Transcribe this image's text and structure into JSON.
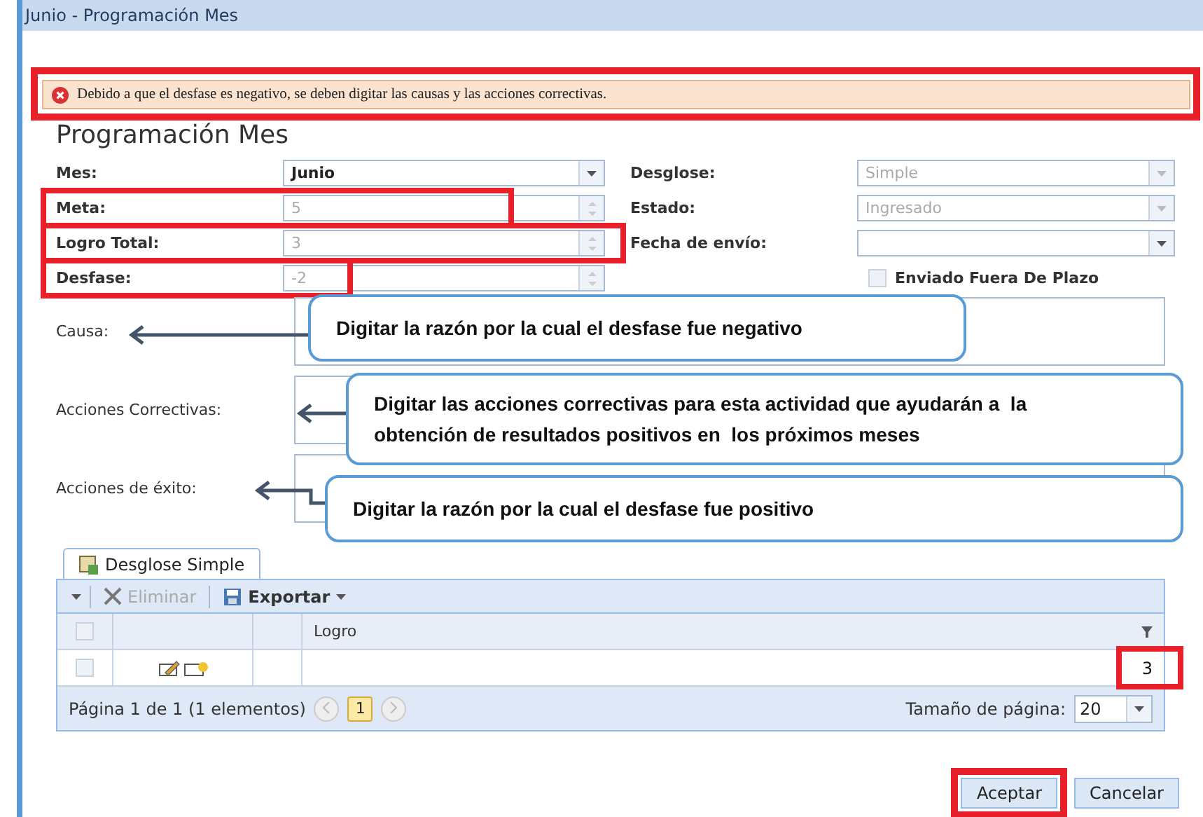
{
  "window": {
    "title": "Junio - Programación Mes"
  },
  "error_banner": {
    "message": "Debido a que el desfase es negativo, se deben digitar las causas y las acciones correctivas.",
    "highlighted": true
  },
  "heading": "Programación Mes",
  "fields_left": [
    {
      "label": "Mes:",
      "value": "Junio",
      "kind": "combo",
      "disabled": false,
      "highlighted": false
    },
    {
      "label": "Meta:",
      "value": "5",
      "kind": "spinner",
      "disabled": true,
      "highlighted": true
    },
    {
      "label": "Logro Total:",
      "value": "3",
      "kind": "spinner",
      "disabled": true,
      "highlighted": true
    },
    {
      "label": "Desfase:",
      "value": "-2",
      "kind": "spinner",
      "disabled": true,
      "highlighted": true
    }
  ],
  "fields_right": [
    {
      "label": "Desglose:",
      "value": "Simple",
      "kind": "combo",
      "disabled": true
    },
    {
      "label": "Estado:",
      "value": "Ingresado",
      "kind": "combo",
      "disabled": true
    },
    {
      "label": "Fecha de envío:",
      "kind": "combo",
      "disabled": false
    }
  ],
  "late_checkbox": {
    "label": "Enviado Fuera De Plazo",
    "checked": false
  },
  "text_areas": [
    {
      "label": "Causa:"
    },
    {
      "label": "Acciones Correctivas:"
    },
    {
      "label": "Acciones de éxito:"
    }
  ],
  "callouts": [
    {
      "text": "Digitar la razón por la cual el desfase fue negativo"
    },
    {
      "text": "Digitar las acciones correctivas para esta actividad que ayudarán a  la obtención de resultados positivos en  los próximos meses"
    },
    {
      "text": "Digitar la razón por la cual el desfase fue positivo"
    }
  ],
  "grid": {
    "tab": {
      "label": "Desglose Simple",
      "selected": true
    },
    "toolbar": [
      {
        "label": "Eliminar",
        "kind": "delete",
        "disabled": true
      },
      {
        "label": "Exportar",
        "kind": "export",
        "disabled": false
      }
    ],
    "select_all_checked": false,
    "columns": [
      "Logro"
    ],
    "rows": [
      {
        "logro": "3",
        "checked": false,
        "highlighted": true
      }
    ],
    "pager": {
      "summary": "Página 1 de 1 (1 elementos)",
      "pages": [
        {
          "label": "1",
          "selected": true
        }
      ],
      "page_size_label": "Tamaño de página:",
      "page_size": "20"
    }
  },
  "buttons": [
    {
      "label": "Aceptar",
      "highlighted": true
    },
    {
      "label": "Cancelar",
      "highlighted": false
    }
  ]
}
